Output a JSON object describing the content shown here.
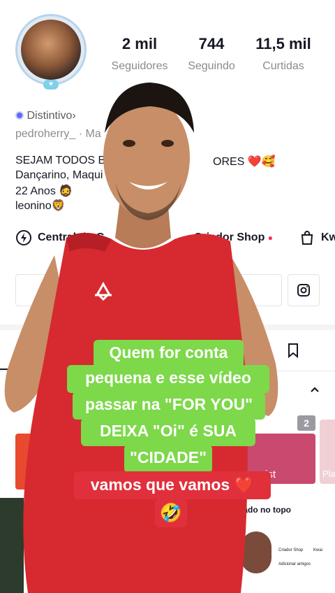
{
  "profile": {
    "stats": [
      {
        "value": "2 mil",
        "label": "Seguidores"
      },
      {
        "value": "744",
        "label": "Seguindo"
      },
      {
        "value": "11,5 mil",
        "label": "Curtidas"
      }
    ],
    "badge_label": "Distintivo",
    "badge_chevron": "›",
    "username_row": "pedroherry_ · Ma",
    "bio_lines": [
      "SEJAM TODOS B",
      "ORES ❤️🥰",
      "Dançarino, Maqui",
      "22 Anos 🧔",
      "leonino🦁"
    ]
  },
  "actions": {
    "central": "Central do C",
    "shop": "Criador Shop",
    "kw": "Kw"
  },
  "grid": {
    "count_badge": "2",
    "tile_texts": [
      "ist",
      "Pla"
    ],
    "pinned_label": "Fixado no topo",
    "mini_shop": "Criador Shop",
    "mini_add": "Adicionar amigos",
    "mini_kwai": "Kwai"
  },
  "caption": {
    "green_lines": [
      "Quem for conta",
      "pequena e esse vídeo",
      "passar na \"FOR YOU\"",
      "DEIXA \"Oi\" é SUA",
      "\"CIDADE\""
    ],
    "red_line": "vamos que vamos ❤️",
    "emoji": "🤣"
  },
  "colors": {
    "caption_green": "#7dd84a",
    "caption_red": "#e0303c",
    "shirt_red": "#d62a30"
  }
}
